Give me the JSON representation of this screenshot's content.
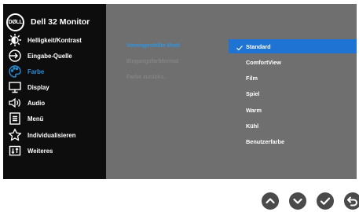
{
  "brand": {
    "logo_text": "DØLL",
    "title": "Dell 32 Monitor"
  },
  "menu": {
    "items": [
      {
        "label": "Helligkeit/Kontrast",
        "icon": "brightness-icon"
      },
      {
        "label": "Eingabe-Quelle",
        "icon": "input-source-icon"
      },
      {
        "label": "Farbe",
        "icon": "color-palette-icon",
        "active": true
      },
      {
        "label": "Display",
        "icon": "display-icon"
      },
      {
        "label": "Audio",
        "icon": "speaker-icon"
      },
      {
        "label": "Menü",
        "icon": "menu-list-icon"
      },
      {
        "label": "Individualisieren",
        "icon": "star-icon"
      },
      {
        "label": "Weiteres",
        "icon": "others-icon"
      }
    ]
  },
  "submenu": {
    "items": [
      {
        "label": "Voreingestellte Modi",
        "active": true
      },
      {
        "label": "Eingangsfarbformat",
        "active": false
      },
      {
        "label": "Farbe zurücks.",
        "active": false
      }
    ]
  },
  "options": {
    "selected": "Standard",
    "items": [
      "Standard",
      "ComfortView",
      "Film",
      "Spiel",
      "Warm",
      "Kühl",
      "Benutzerfarbe"
    ]
  },
  "hardware_buttons": [
    "up-icon",
    "down-icon",
    "ok-check-icon",
    "back-icon"
  ],
  "colors": {
    "sidebar_bg": "#0d0d0d",
    "content_bg": "#6f6f6f",
    "accent": "#1f73d2",
    "active_text": "#2a8fd8",
    "button_bg": "#4a4a4a"
  }
}
